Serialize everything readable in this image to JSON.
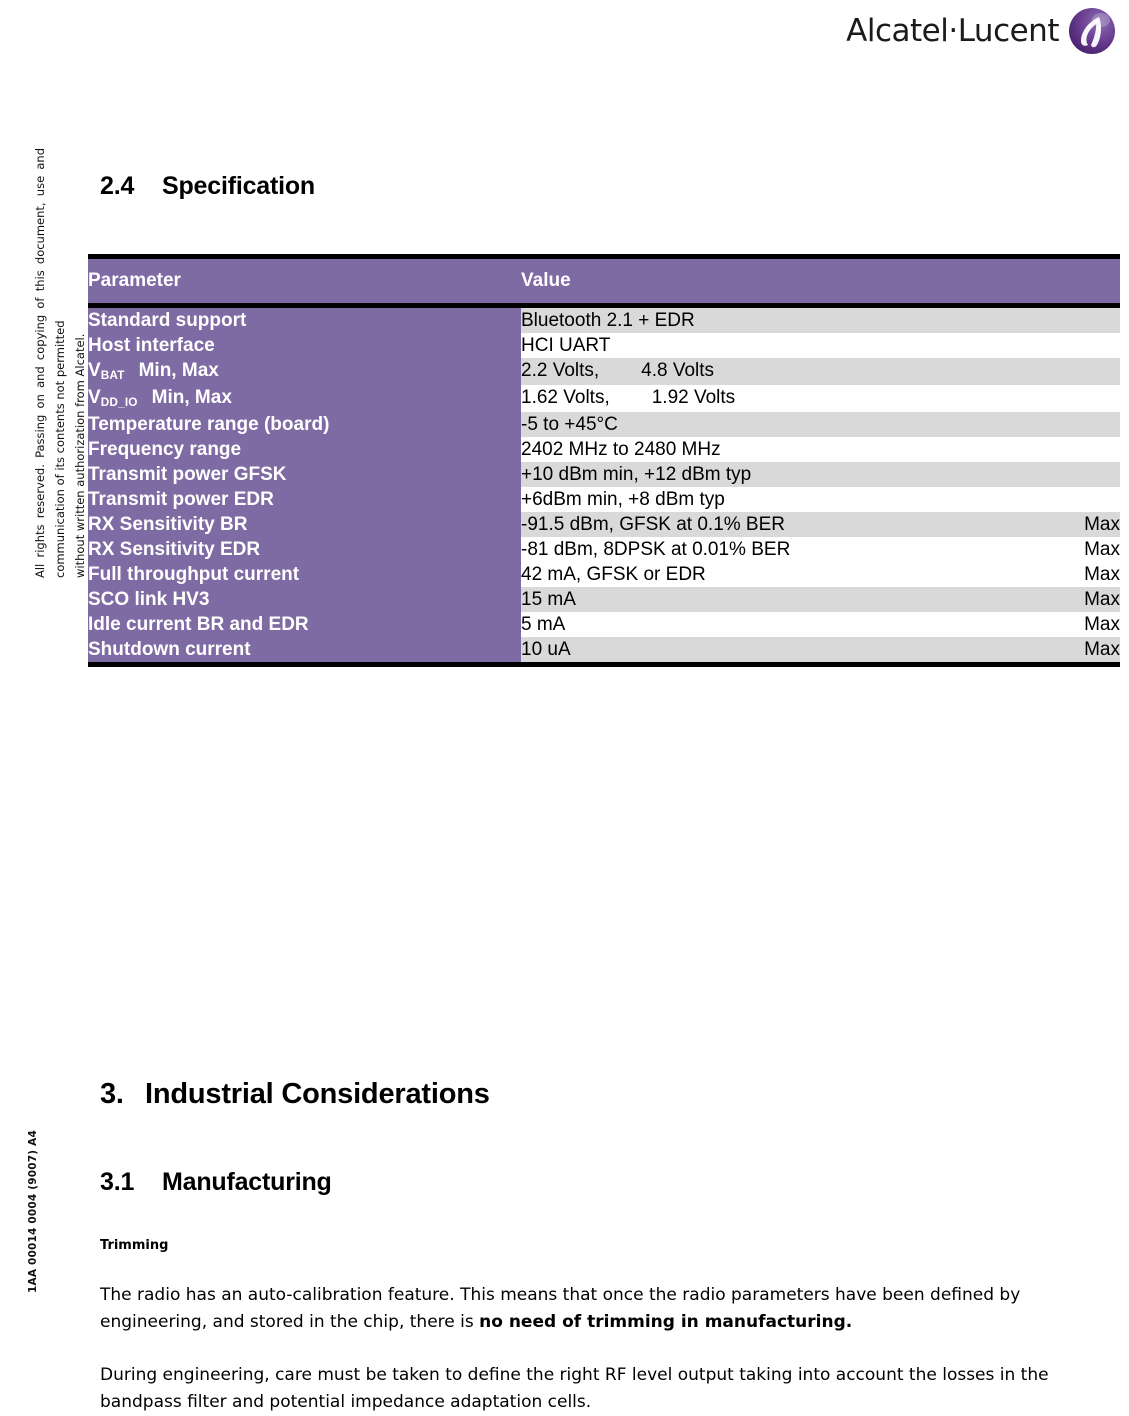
{
  "header": {
    "brand_wordmark": "Alcatel·Lucent",
    "emblem_icon": "alcatel-lucent-emblem-icon"
  },
  "side": {
    "copyright_notice": "All rights reserved. Passing on and copying of this document, use and communication of its contents not permitted\nwithout written authorization from Alcatel.",
    "doc_reference": "1AA 00014 0004 (9007) A4"
  },
  "headings": {
    "spec_number": "2.4",
    "spec_title": "Specification",
    "industrial_number": "3.",
    "industrial_title": "Industrial Considerations",
    "manufacturing_number": "3.1",
    "manufacturing_title": "Manufacturing",
    "trimming_label": "Trimming"
  },
  "table": {
    "columns": [
      "Parameter",
      "Value",
      ""
    ],
    "rows": [
      {
        "parameter": "Standard support",
        "param_sub": "",
        "param_suffix": "",
        "value": "Bluetooth 2.1 + EDR",
        "value2": "",
        "note": "",
        "shade": "gray"
      },
      {
        "parameter": "Host interface",
        "param_sub": "",
        "param_suffix": "",
        "value": "HCI UART",
        "value2": "",
        "note": "",
        "shade": "white"
      },
      {
        "parameter": "V",
        "param_sub": "BAT",
        "param_suffix": "Min, Max",
        "value": "2.2 Volts,",
        "value2": "4.8 Volts",
        "note": "",
        "shade": "gray"
      },
      {
        "parameter": "V",
        "param_sub": "DD_IO",
        "param_suffix": "Min, Max",
        "value": "1.62 Volts,",
        "value2": "1.92 Volts",
        "note": "",
        "shade": "white"
      },
      {
        "parameter": "Temperature range (board)",
        "param_sub": "",
        "param_suffix": "",
        "value": "-5 to +45°C",
        "value2": "",
        "note": "",
        "shade": "gray"
      },
      {
        "parameter": "Frequency range",
        "param_sub": "",
        "param_suffix": "",
        "value": "2402 MHz to 2480 MHz",
        "value2": "",
        "note": "",
        "shade": "white"
      },
      {
        "parameter": "Transmit power GFSK",
        "param_sub": "",
        "param_suffix": "",
        "value": "+10 dBm min, +12 dBm typ",
        "value2": "",
        "note": "",
        "shade": "gray"
      },
      {
        "parameter": "Transmit power EDR",
        "param_sub": "",
        "param_suffix": "",
        "value": "+6dBm min, +8 dBm typ",
        "value2": "",
        "note": "",
        "shade": "white"
      },
      {
        "parameter": "RX Sensitivity BR",
        "param_sub": "",
        "param_suffix": "",
        "value": "-91.5 dBm, GFSK at 0.1% BER",
        "value2": "",
        "note": "Max",
        "shade": "gray"
      },
      {
        "parameter": "RX Sensitivity EDR",
        "param_sub": "",
        "param_suffix": "",
        "value": "-81 dBm, 8DPSK at 0.01% BER",
        "value2": "",
        "note": "Max",
        "shade": "white"
      },
      {
        "parameter": "Full throughput current",
        "param_sub": "",
        "param_suffix": "",
        "value": "42 mA, GFSK or EDR",
        "value2": "",
        "note": "Max",
        "shade": "white"
      },
      {
        "parameter": "SCO link HV3",
        "param_sub": "",
        "param_suffix": "",
        "value": "15 mA",
        "value2": "",
        "note": "Max",
        "shade": "gray"
      },
      {
        "parameter": "Idle current BR and EDR",
        "param_sub": "",
        "param_suffix": "",
        "value": "5 mA",
        "value2": "",
        "note": "Max",
        "shade": "white"
      },
      {
        "parameter": "Shutdown current",
        "param_sub": "",
        "param_suffix": "",
        "value": "10 uA",
        "value2": "",
        "note": "Max",
        "shade": "gray"
      }
    ]
  },
  "paragraphs": {
    "trimming_text_part1": "The radio has an auto-calibration feature. This means that once the radio parameters have been defined by engineering, and stored in the chip, there is ",
    "trimming_text_bold": "no need of trimming in manufacturing.",
    "engineering_text": "During engineering, care must be taken to define the right RF level output taking into account the losses in the bandpass filter and potential impedance adaptation cells."
  },
  "colors": {
    "table_purple": "#7e6ba4",
    "row_gray": "#d9d9d9",
    "rule_black": "#000000",
    "brand_purple": "#6b3f92"
  }
}
